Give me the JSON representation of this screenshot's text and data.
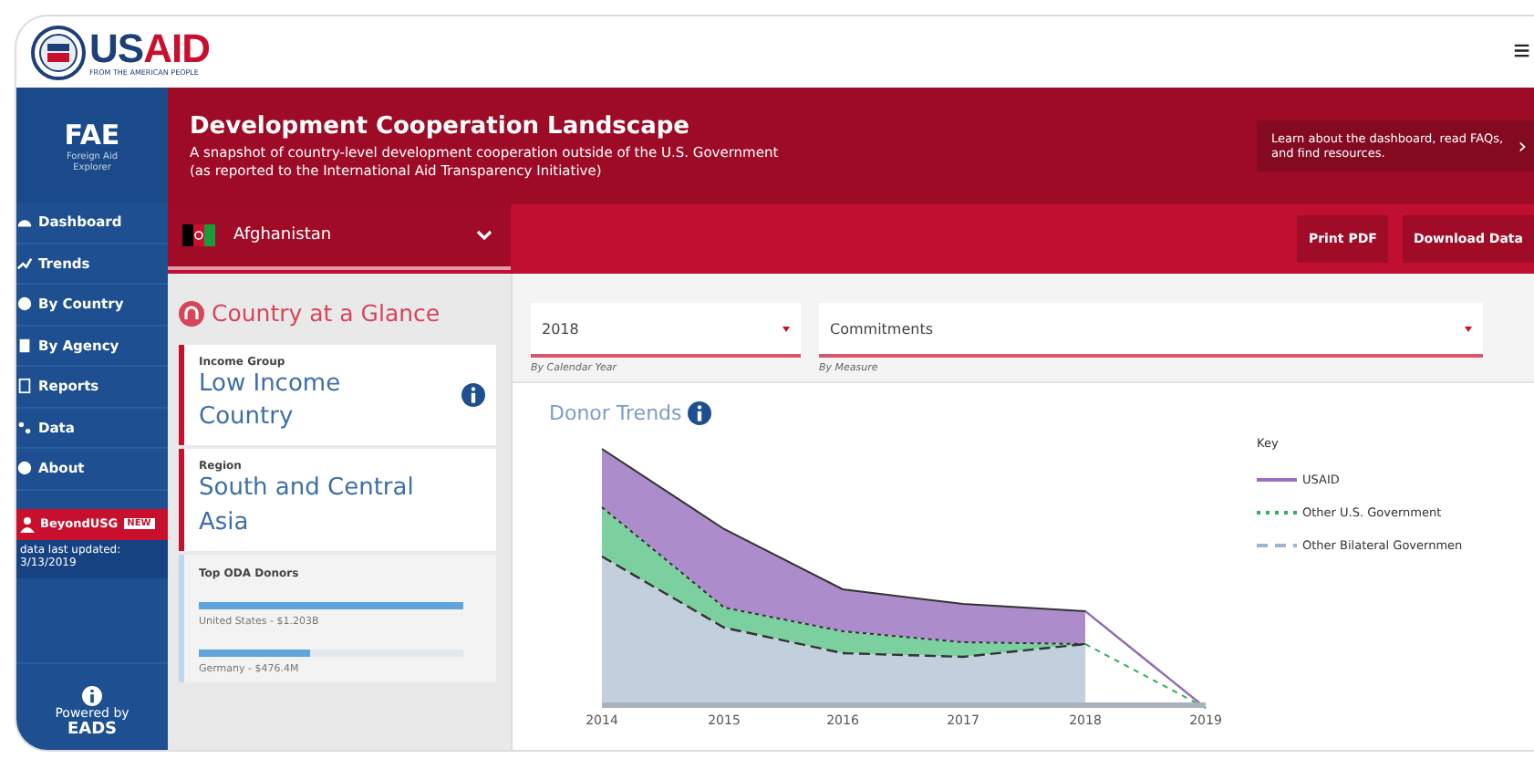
{
  "header": {
    "logo_parts": [
      "US",
      "AID"
    ],
    "tagline": "FROM THE AMERICAN PEOPLE",
    "menu_glyph": "≡"
  },
  "sidebar": {
    "brand": "FAE",
    "brand_sub": "Foreign Aid Explorer",
    "items": [
      {
        "label": "Dashboard"
      },
      {
        "label": "Trends"
      },
      {
        "label": "By Country"
      },
      {
        "label": "By Agency"
      },
      {
        "label": "Reports"
      },
      {
        "label": "Data"
      },
      {
        "label": "About"
      }
    ],
    "highlight": {
      "label": "BeyondUSG",
      "badge": "NEW"
    },
    "updated": "data last updated: 3/13/2019",
    "footer": {
      "line1": "Powered by",
      "line2": "EADS"
    }
  },
  "banner": {
    "title": "Development Cooperation Landscape",
    "subtitle": [
      "A snapshot of country-level development cooperation outside of the U.S. Government",
      "(as reported to the International Aid Transparency Initiative)"
    ],
    "help_text": "Learn about the dashboard, read FAQs, and find resources.",
    "help_glyph": "›"
  },
  "toolbar": {
    "country": "Afghanistan",
    "buttons": [
      "Print PDF",
      "Download Data"
    ]
  },
  "glance": {
    "title": "Country at a Glance",
    "facts": [
      {
        "label": "Income Group",
        "value": "Low Income Country",
        "info": true
      },
      {
        "label": "Region",
        "value": "South and Central Asia",
        "info": false
      }
    ],
    "donors": {
      "title": "Top ODA Donors",
      "items": [
        {
          "text": "United States - $1.203B",
          "level": 1.0
        },
        {
          "text": "Germany - $476.4M",
          "level": 0.42
        }
      ]
    }
  },
  "filters": [
    {
      "value": "2018",
      "caption": "By Calendar Year"
    },
    {
      "value": "Commitments",
      "caption": "By Measure"
    }
  ],
  "trends": {
    "title": "Donor Trends",
    "x_labels": [
      "2014",
      "2015",
      "2016",
      "2017",
      "2018",
      "2019"
    ],
    "key_title": "Key",
    "key": [
      {
        "label": "USAID",
        "color": "#9b6fc4"
      },
      {
        "label": "Other U.S. Government",
        "color": "#2fae5e"
      },
      {
        "label": "Other Bilateral Governmen",
        "color": "#9fb4d0"
      }
    ]
  }
}
